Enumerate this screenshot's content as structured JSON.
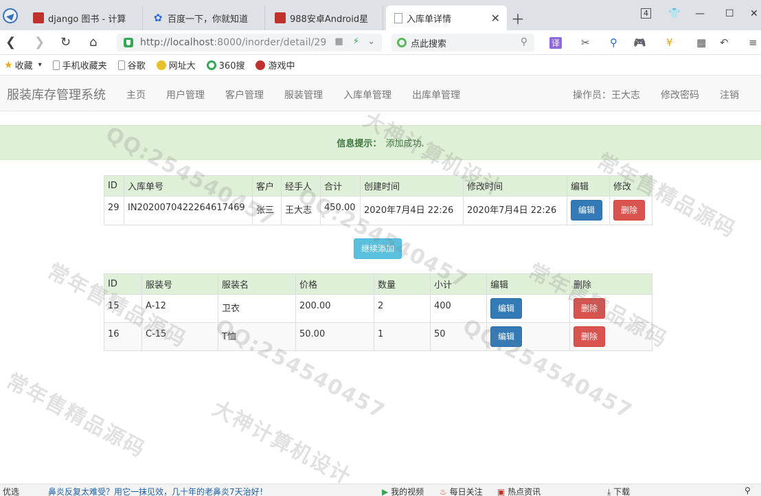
{
  "browser": {
    "tabs": [
      {
        "label": "django 图书 - 计算",
        "icon": "red-square-icon"
      },
      {
        "label": "百度一下，你就知道",
        "icon": "paw-icon"
      },
      {
        "label": "988安卓Android星",
        "icon": "red-square-icon"
      },
      {
        "label": "入库单详情",
        "icon": "document-icon",
        "active": true
      }
    ],
    "tab_count_badge": "4",
    "url_host": "http://localhost",
    "url_path": ":8000/inorder/detail/29",
    "search_placeholder": "点此搜索",
    "bookmarks": [
      "收藏",
      "手机收藏夹",
      "谷歌",
      "网址大",
      "360搜",
      "游戏中"
    ]
  },
  "navbar": {
    "brand": "服装库存管理系统",
    "links": [
      "主页",
      "用户管理",
      "客户管理",
      "服装管理",
      "入库单管理",
      "出库单管理"
    ],
    "operator": "操作员：王大志",
    "change_password": "修改密码",
    "logout": "注销"
  },
  "alert": {
    "label": "信息提示：",
    "message": "添加成功."
  },
  "order_table": {
    "headers": [
      "ID",
      "入库单号",
      "客户",
      "经手人",
      "合计",
      "创建时间",
      "修改时间",
      "编辑",
      "修改"
    ],
    "row": {
      "id": "29",
      "number": "IN2020070422264617469",
      "customer": "张三",
      "handler": "王大志",
      "total": "450.00",
      "created": "2020年7月4日 22:26",
      "modified": "2020年7月4日 22:26",
      "edit_label": "编辑",
      "delete_label": "删除"
    }
  },
  "continue_button": "继续添加",
  "items_table": {
    "headers": [
      "ID",
      "服装号",
      "服装名",
      "价格",
      "数量",
      "小计",
      "编辑",
      "删除"
    ],
    "rows": [
      {
        "id": "15",
        "code": "A-12",
        "name": "卫衣",
        "price": "200.00",
        "qty": "2",
        "subtotal": "400",
        "edit_label": "编辑",
        "delete_label": "删除"
      },
      {
        "id": "16",
        "code": "C-15",
        "name": "T恤",
        "price": "50.00",
        "qty": "1",
        "subtotal": "50",
        "edit_label": "编辑",
        "delete_label": "删除"
      }
    ]
  },
  "watermarks": [
    "QQ:254540457",
    "常年售精品源码",
    "大神计算机设计"
  ],
  "statusbar": {
    "left": "优选",
    "news": "鼻炎反复太难受？用它一抹见效，几十年的老鼻炎7天治好！",
    "video": "我的视频",
    "follow": "每日关注",
    "hot": "热点资讯",
    "download": "下载"
  }
}
